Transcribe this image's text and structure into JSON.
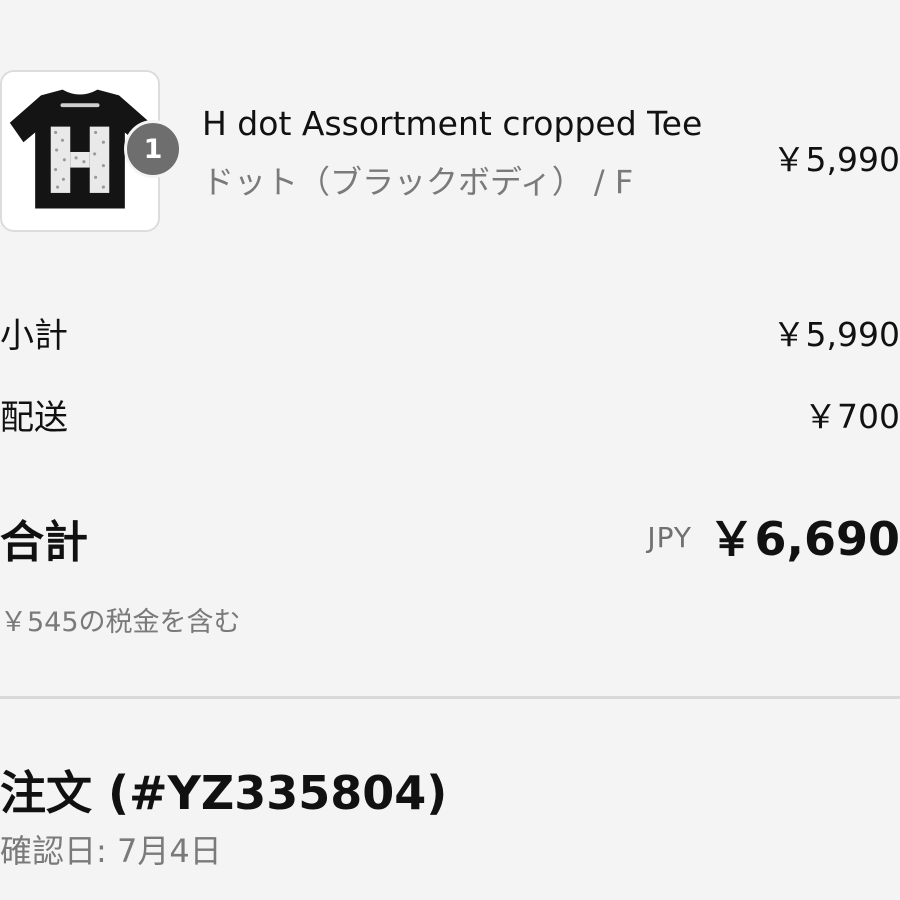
{
  "line_item": {
    "quantity": "1",
    "title": "H dot Assortment cropped Tee",
    "variant": "ドット（ブラックボディ） / F",
    "price": "￥5,990",
    "thumbnail_icon": "black-cropped-tee-with-white-h-image"
  },
  "summary": {
    "subtotal_label": "小計",
    "subtotal_value": "￥5,990",
    "shipping_label": "配送",
    "shipping_value": "￥700",
    "total_label": "合計",
    "total_currency": "JPY",
    "total_value": "￥6,690",
    "tax_note": "￥545の税金を含む"
  },
  "order": {
    "title": "注文 (#YZ335804)",
    "confirmed_date": "確認日: 7月4日"
  },
  "colors": {
    "background": "#f4f4f4",
    "badge": "#6e6e6e",
    "muted_text": "#7a7a7a",
    "divider": "#d9d9d9"
  }
}
